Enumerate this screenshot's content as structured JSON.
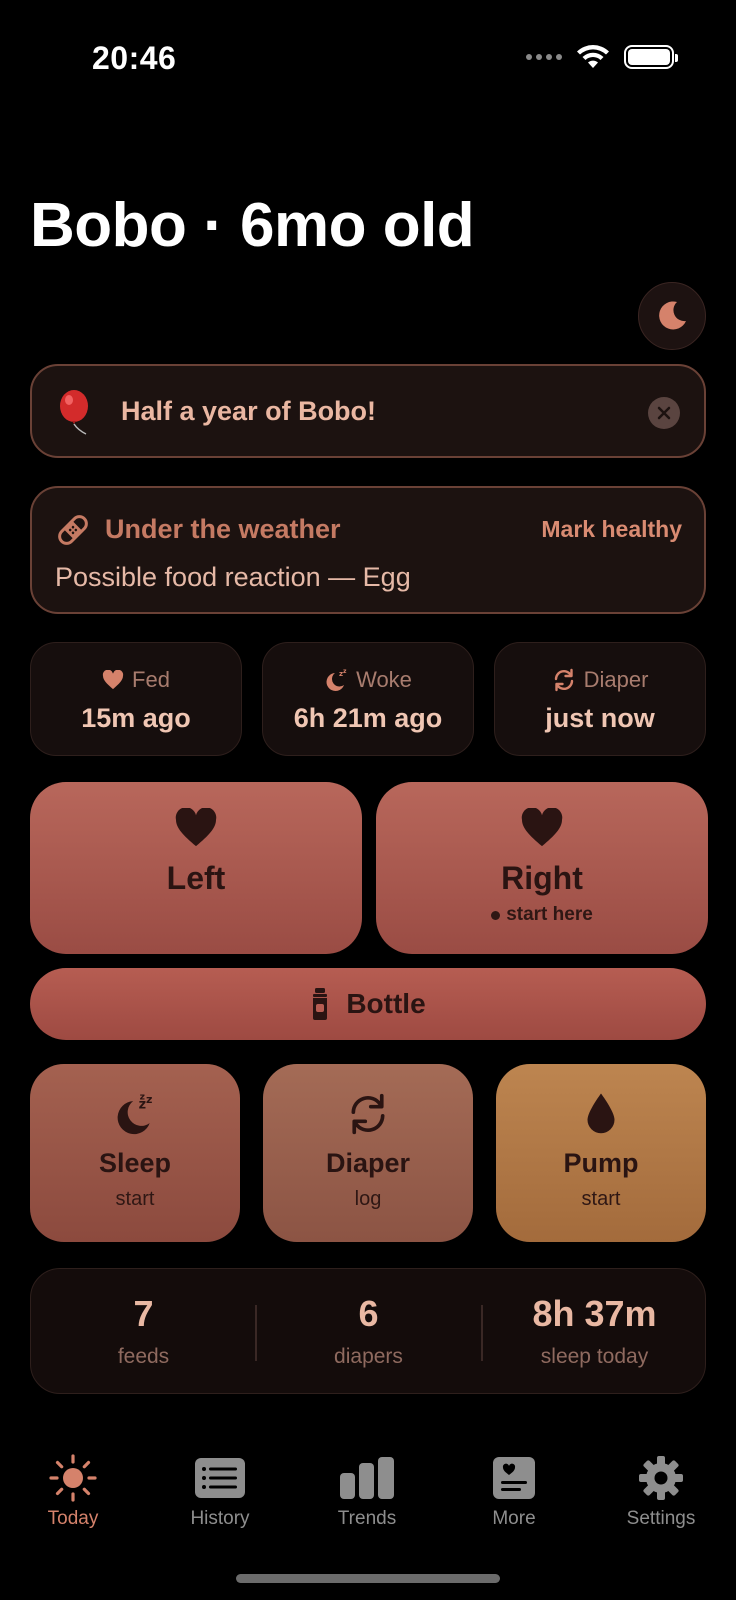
{
  "status": {
    "time": "20:46"
  },
  "header": {
    "title": "Bobo · 6mo old"
  },
  "banner": {
    "text": "Half a year of Bobo!"
  },
  "health": {
    "title": "Under the weather",
    "action": "Mark healthy",
    "subtitle": "Possible food reaction — Egg"
  },
  "stats": [
    {
      "label": "Fed",
      "value": "15m ago",
      "icon": "heart-icon"
    },
    {
      "label": "Woke",
      "value": "6h 21m ago",
      "icon": "moon-zzz-icon"
    },
    {
      "label": "Diaper",
      "value": "just now",
      "icon": "cycle-arrows-icon"
    }
  ],
  "feed": {
    "left": {
      "label": "Left"
    },
    "right": {
      "label": "Right",
      "hint": "start here"
    },
    "bottle": {
      "label": "Bottle"
    }
  },
  "actions": [
    {
      "label": "Sleep",
      "sub": "start",
      "icon": "moon-zzz-icon"
    },
    {
      "label": "Diaper",
      "sub": "log",
      "icon": "cycle-arrows-icon"
    },
    {
      "label": "Pump",
      "sub": "start",
      "icon": "drop-icon"
    }
  ],
  "summary": [
    {
      "value": "7",
      "label": "feeds"
    },
    {
      "value": "6",
      "label": "diapers"
    },
    {
      "value": "8h 37m",
      "label": "sleep today"
    }
  ],
  "tabs": [
    {
      "label": "Today",
      "icon": "sun-icon",
      "active": true
    },
    {
      "label": "History",
      "icon": "list-icon",
      "active": false
    },
    {
      "label": "Trends",
      "icon": "bar-chart-icon",
      "active": false
    },
    {
      "label": "More",
      "icon": "card-heart-icon",
      "active": false
    },
    {
      "label": "Settings",
      "icon": "gear-icon",
      "active": false
    }
  ],
  "colors": {
    "accent": "#d5826b",
    "card_bg": "#1c1210",
    "card_border": "#6a4136",
    "feed_button": "#b8675b",
    "pump_button": "#bd8550"
  }
}
